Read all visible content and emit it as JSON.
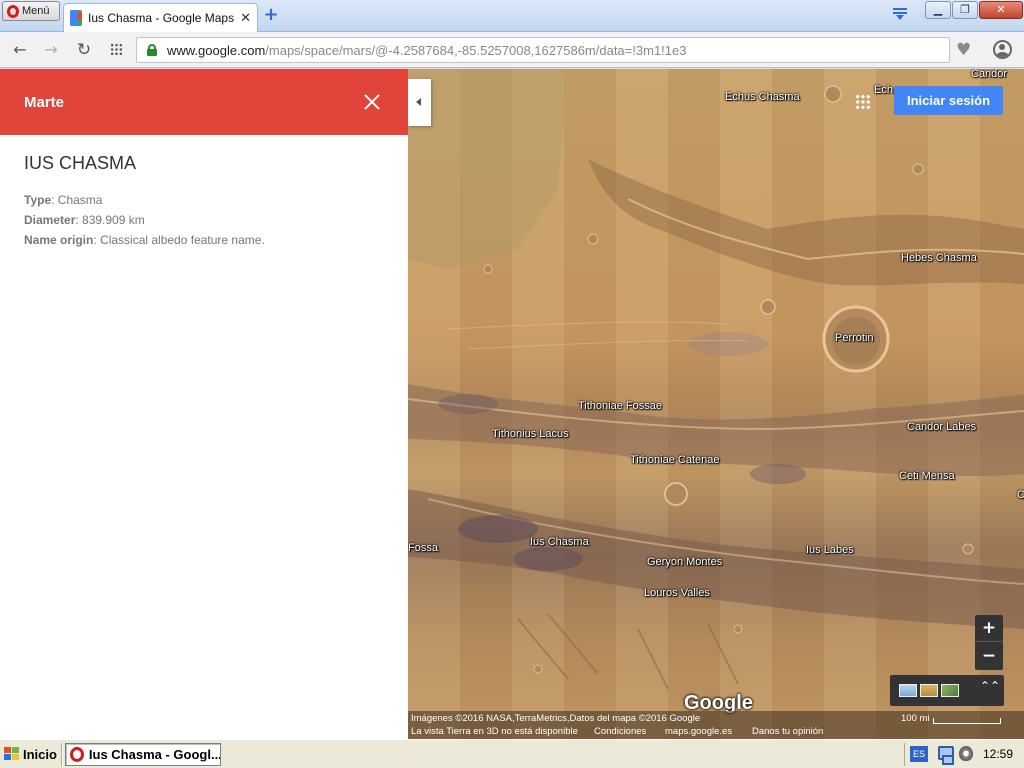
{
  "browser": {
    "menu_label": "Menú",
    "tab_title": "Ius Chasma - Google Maps",
    "tab_close": "✕",
    "new_tab": "+",
    "url_host": "www.google.com",
    "url_path": "/maps/space/mars/@-4.2587684,-85.5257008,1627586m/data=!3m1!1e3",
    "window_min": "▁",
    "window_max": "❐",
    "window_close": "✕"
  },
  "panel": {
    "title": "Marte",
    "feature_name": "IUS CHASMA",
    "properties": [
      {
        "label": "Type",
        "value": ": Chasma"
      },
      {
        "label": "Diameter",
        "value": ": 839.909 km"
      },
      {
        "label": "Name origin",
        "value": ": Classical albedo feature name."
      }
    ]
  },
  "map": {
    "signin_label": "Iniciar sesión",
    "labels": [
      {
        "name": "candor",
        "text": "Candor"
      },
      {
        "name": "echus-chasma",
        "text": "Echus Chasma"
      },
      {
        "name": "echus-partial",
        "text": "Ech"
      },
      {
        "name": "hebes-chasma",
        "text": "Hebes Chasma"
      },
      {
        "name": "perrotin",
        "text": "Perrotin"
      },
      {
        "name": "tithoniae-fossae",
        "text": "Tithoniae Fossae"
      },
      {
        "name": "tithonius-lacus",
        "text": "Tithonius Lacus"
      },
      {
        "name": "candor-labes",
        "text": "Candor Labes"
      },
      {
        "name": "tithoniae-catenae",
        "text": "Tithoniae Catenae"
      },
      {
        "name": "ceti-mensa",
        "text": "Ceti Mensa"
      },
      {
        "name": "c-partial",
        "text": "C"
      },
      {
        "name": "fossa",
        "text": "Fossa"
      },
      {
        "name": "ius-chasma",
        "text": "Ius Chasma"
      },
      {
        "name": "ius-labes",
        "text": "Ius Labes"
      },
      {
        "name": "geryon-montes",
        "text": "Geryon Montes"
      },
      {
        "name": "louros-valles",
        "text": "Louros Valles"
      }
    ],
    "zoom_in": "+",
    "zoom_out": "−",
    "layers_expand": "⌃⌃",
    "logo": "Google",
    "attribution": "Imágenes ©2016 NASA,TerraMetrics,Datos del mapa ©2016 Google",
    "earth_3d_notice": "La vista Tierra en 3D no está disponible",
    "terms": "Condiciones",
    "maps_link": "maps.google.es",
    "feedback": "Danos tu opinión",
    "scale": "100 mi"
  },
  "taskbar": {
    "start_label": "Inicio",
    "task_label": "Ius Chasma - Googl...",
    "lang": "ES",
    "clock": "12:59"
  }
}
